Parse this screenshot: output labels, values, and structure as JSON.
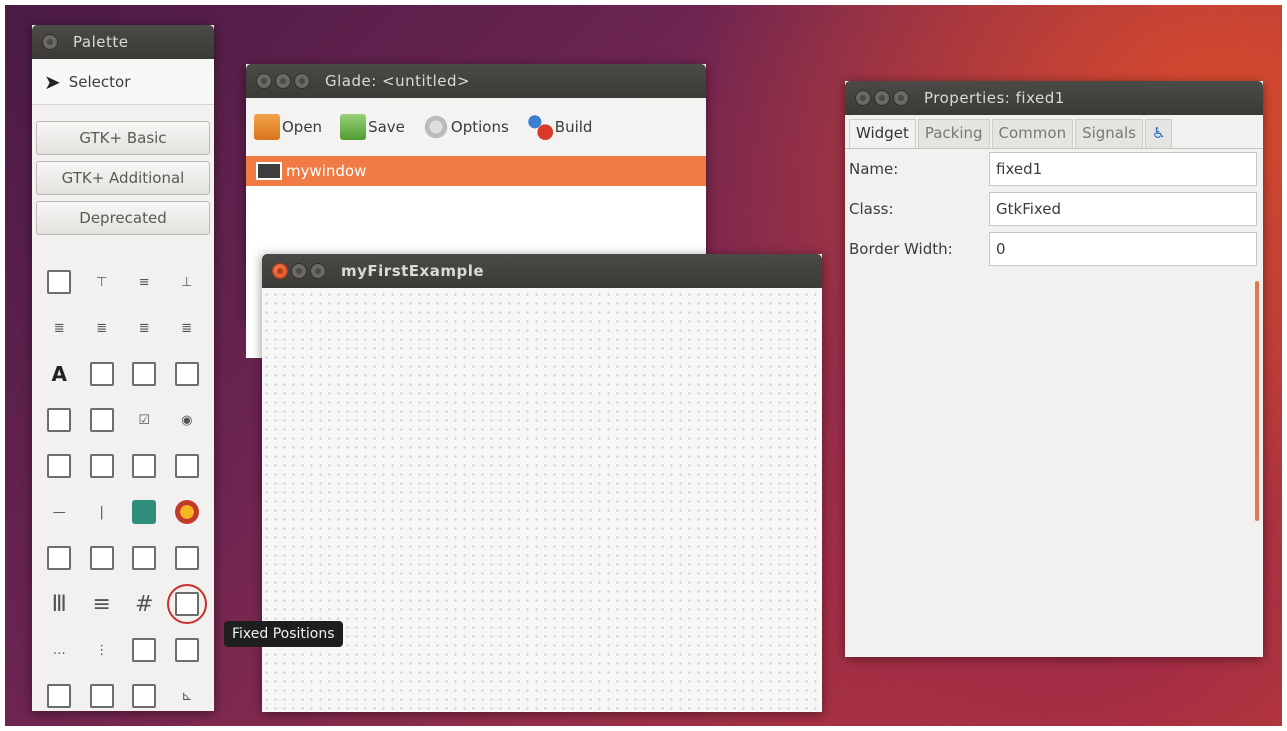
{
  "palette": {
    "title": "Palette",
    "selector_label": "Selector",
    "groups": [
      "GTK+ Basic",
      "GTK+ Additional",
      "Deprecated"
    ],
    "icons": [
      [
        "window-icon",
        "assistant-icon",
        "label-row-icon",
        "toolbar-icon"
      ],
      [
        "frame-icon",
        "aspect-frame-icon",
        "label-icon",
        "table-icon"
      ],
      [
        "label-a-icon",
        "image-icon",
        "notebook-icon",
        "textview-icon"
      ],
      [
        "button-icon",
        "entry-icon",
        "check-icon",
        "radio-icon"
      ],
      [
        "spin-icon",
        "toggle-icon",
        "combo-icon",
        "menu-icon"
      ],
      [
        "separator-h-icon",
        "separator-v-icon",
        "image-widget-icon",
        "color-button-icon"
      ],
      [
        "scale-icon",
        "progress-icon",
        "calendar-icon",
        "drawing-icon"
      ],
      [
        "hbox-icon",
        "vbox-icon",
        "grid-icon",
        "fixed-icon"
      ],
      [
        "statusbar-icon",
        "scrollbar-icon",
        "paned-icon",
        "layout-icon"
      ],
      [
        "event-box-icon",
        "expander-icon",
        "viewport-icon",
        "alignment-icon"
      ]
    ],
    "tooltip": "Fixed Positions"
  },
  "glade": {
    "title": "Glade: <untitled>",
    "toolbar": {
      "open": "Open",
      "save": "Save",
      "options": "Options",
      "build": "Build"
    },
    "tree_item": "mywindow"
  },
  "example": {
    "title": "myFirstExample"
  },
  "properties": {
    "title": "Properties: fixed1",
    "tabs": [
      "Widget",
      "Packing",
      "Common",
      "Signals"
    ],
    "rows": [
      {
        "label": "Name:",
        "value": "fixed1"
      },
      {
        "label": "Class:",
        "value": "GtkFixed"
      },
      {
        "label": "Border Width:",
        "value": "0"
      }
    ]
  }
}
